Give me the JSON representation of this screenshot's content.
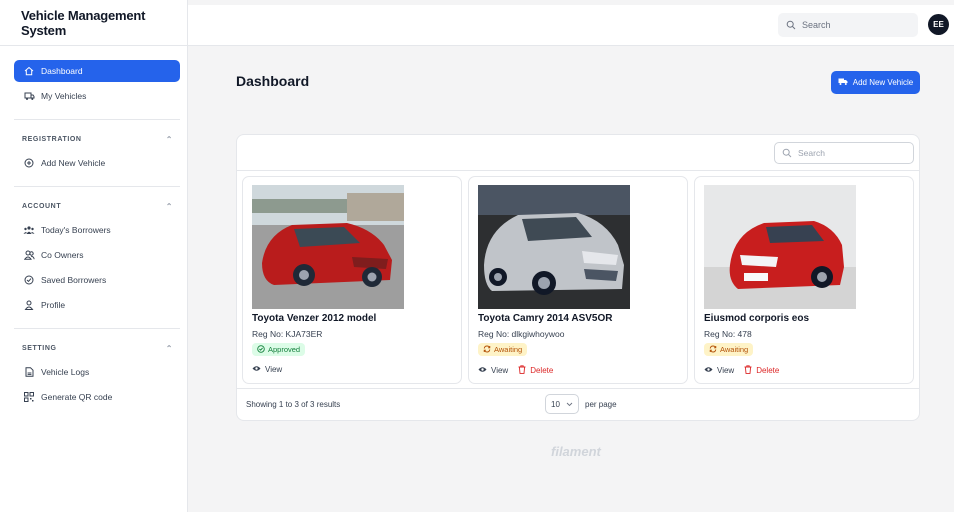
{
  "app": {
    "title": "Vehicle Management System"
  },
  "sidebar": {
    "top_items": [
      {
        "label": "Dashboard",
        "icon": "home-icon",
        "active": true
      },
      {
        "label": "My Vehicles",
        "icon": "car-icon"
      }
    ],
    "groups": [
      {
        "title": "REGISTRATION",
        "items": [
          {
            "label": "Add New Vehicle",
            "icon": "plus-circle-icon"
          }
        ]
      },
      {
        "title": "ACCOUNT",
        "items": [
          {
            "label": "Today's Borrowers",
            "icon": "users-group-icon"
          },
          {
            "label": "Co Owners",
            "icon": "users-icon"
          },
          {
            "label": "Saved Borrowers",
            "icon": "check-circle-icon"
          },
          {
            "label": "Profile",
            "icon": "user-icon"
          }
        ]
      },
      {
        "title": "SETTING",
        "items": [
          {
            "label": "Vehicle Logs",
            "icon": "document-icon"
          },
          {
            "label": "Generate QR code",
            "icon": "qr-code-icon"
          }
        ]
      }
    ]
  },
  "topbar": {
    "search_placeholder": "Search",
    "avatar_initials": "EE"
  },
  "main": {
    "title": "Dashboard",
    "add_button": "Add New Vehicle",
    "table_search_placeholder": "Search",
    "cards": [
      {
        "title": "Toyota Venzer 2012 model",
        "reg": "Reg No: KJA73ER",
        "status": "Approved",
        "status_kind": "approved",
        "view": "View",
        "delete": null,
        "car_color": "#b91c1c"
      },
      {
        "title": "Toyota Camry 2014 ASV5OR",
        "reg": "Reg No: dlkgiwhoywoo",
        "status": "Awaiting",
        "status_kind": "awaiting",
        "view": "View",
        "delete": "Delete",
        "car_color": "#c0c4c9"
      },
      {
        "title": "Eiusmod corporis eos",
        "reg": "Reg No: 478",
        "status": "Awaiting",
        "status_kind": "awaiting",
        "view": "View",
        "delete": "Delete",
        "car_color": "#c81e1e"
      }
    ],
    "results_text": "Showing 1 to 3 of 3 results",
    "per_page_value": "10",
    "per_page_label": "per page",
    "footer_brand": "filament"
  },
  "colors": {
    "primary": "#2563eb",
    "approved": "#15803d",
    "awaiting": "#b45309",
    "danger": "#dc2626"
  }
}
